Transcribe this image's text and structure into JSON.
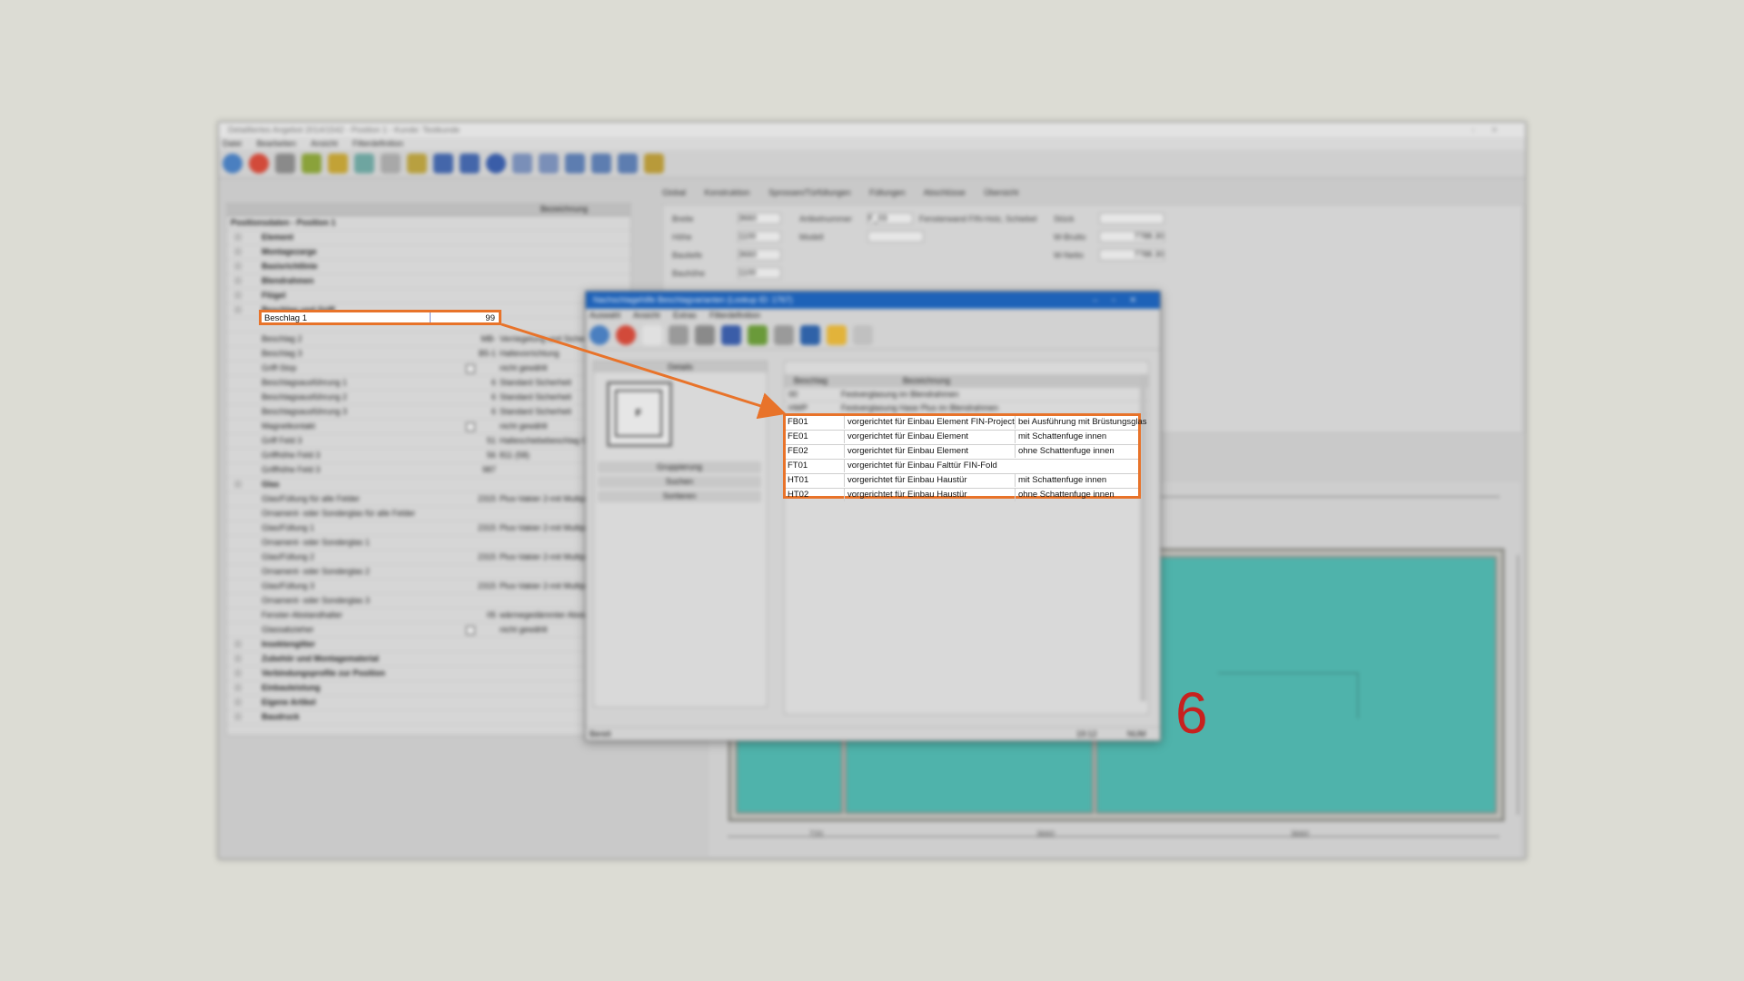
{
  "main_window": {
    "title": "Detailliertes Angebot 2014/1542 - Position 1 - Kunde: Testkunde",
    "menu": [
      "Datei",
      "Bearbeiten",
      "Ansicht",
      "Filterdefinition"
    ]
  },
  "tree": {
    "header_col": "Bezeichnung",
    "section_label": "Positionsdaten - Position 1",
    "rows": [
      {
        "label": "Element",
        "bold": true
      },
      {
        "label": "Montagezarge",
        "bold": true
      },
      {
        "label": "Basisrichtlinie",
        "bold": true
      },
      {
        "label": "Blendrahmen",
        "bold": true
      },
      {
        "label": "Flügel",
        "bold": true
      },
      {
        "label": "Beschlag und Griff",
        "bold": true
      },
      {
        "label": "",
        "bold": false,
        "highlight": true
      },
      {
        "label": "Beschlag 2",
        "num": "MB-",
        "desc": "Verriegelung und Sicherheit"
      },
      {
        "label": "Beschlag 3",
        "num": "B5-1",
        "desc": "Haltevorrichtung"
      },
      {
        "label": "Griff-Stop",
        "checkbox": true,
        "desc": "nicht gewählt"
      },
      {
        "label": "Beschlagsausführung 1",
        "num": "6",
        "desc": "Standard Sicherheit"
      },
      {
        "label": "Beschlagsausführung 2",
        "num": "6",
        "desc": "Standard Sicherheit"
      },
      {
        "label": "Beschlagsausführung 3",
        "num": "6",
        "desc": "Standard Sicherheit"
      },
      {
        "label": "Magnetkontakt",
        "checkbox": true,
        "desc": "nicht gewählt"
      },
      {
        "label": "Griff Feld 3",
        "num": "51",
        "desc": "Halteschiebebeschlag Griff"
      },
      {
        "label": "Griffhöhe Feld 3",
        "num": "56",
        "desc": "811 (58)"
      },
      {
        "label": "Griffhöhe Feld 3",
        "num": "987",
        "desc": ""
      },
      {
        "label": "Glas",
        "bold": true
      },
      {
        "label": "Glas/Füllung für alle Felder",
        "num": "2315",
        "desc": "Plus-Vakier 2-mit Multiprotect"
      },
      {
        "label": "Ornament- oder Sonderglas für alle Felder",
        "num": "",
        "desc": ""
      },
      {
        "label": "Glas/Füllung 1",
        "num": "2315",
        "desc": "Plus-Vakier 2-mit Multiprotect"
      },
      {
        "label": "Ornament- oder Sonderglas 1",
        "num": "",
        "desc": ""
      },
      {
        "label": "Glas/Füllung 2",
        "num": "2315",
        "desc": "Plus-Vakier 2-mit Multiprotect"
      },
      {
        "label": "Ornament- oder Sonderglas 2",
        "num": "",
        "desc": ""
      },
      {
        "label": "Glas/Füllung 3",
        "num": "2315",
        "desc": "Plus-Vakier 2-mit Multiprotect"
      },
      {
        "label": "Ornament- oder Sonderglas 3",
        "num": "",
        "desc": ""
      },
      {
        "label": "Fenster-Abstandhalter",
        "num": "05",
        "desc": "wärmegedämmter Abstandhalter"
      },
      {
        "label": "Glassabzieher",
        "checkbox": true,
        "desc": "nicht gewählt"
      },
      {
        "label": "Insektengitter",
        "bold": true
      },
      {
        "label": "Zubehör und Montagematerial",
        "bold": true
      },
      {
        "label": "Verbindungsprofile zur Position",
        "bold": true
      },
      {
        "label": "Einbauleistung",
        "bold": true
      },
      {
        "label": "Eigene Artikel",
        "bold": true
      },
      {
        "label": "Baudruck",
        "bold": true
      }
    ]
  },
  "highlight_row": {
    "label": "Beschlag 1",
    "value": "99"
  },
  "tabs": [
    "Global",
    "Konstruktion",
    "Sprossen/Türfüllungen",
    "Füllungen",
    "Abschlüsse",
    "Übersicht"
  ],
  "props": {
    "labels": [
      "Breite",
      "Höhe",
      "Bautiefe",
      "Bauhöhe",
      "Artikelnummer",
      "Modell",
      "Stück",
      "W-Brutto",
      "W-Netto"
    ],
    "values": [
      "3660",
      "1100",
      "3660",
      "1100",
      "F_03",
      "Fensterwand FIN-Holz, Schiebel",
      "7788.30",
      "7788.30"
    ]
  },
  "popup": {
    "title": "Nachschlagehilfe Beschlagvarianten (Lookup ID: 1767)",
    "menu": [
      "Auswahl",
      "Ansicht",
      "Extras",
      "Filterdefinition"
    ],
    "left_header": "Details",
    "preview_letter": "F",
    "left_buttons": [
      "Gruppierung",
      "Suchen",
      "Sortieren"
    ],
    "grid_headers": [
      "Beschlag",
      "Bezeichnung",
      ""
    ],
    "grid_top_rows": [
      {
        "code": "00",
        "desc": "Festverglasung im Blendrahmen",
        "note": ""
      },
      {
        "code": "HWP",
        "desc": "Festverglasung Hase Plus im Blendrahmen",
        "note": ""
      }
    ],
    "grid_highlight_rows": [
      {
        "code": "FB01",
        "desc": "vorgerichtet für Einbau Element FIN-Project",
        "note": "bei Ausführung mit Brüstungsglas"
      },
      {
        "code": "FE01",
        "desc": "vorgerichtet für Einbau Element",
        "note": "mit Schattenfuge innen"
      },
      {
        "code": "FE02",
        "desc": "vorgerichtet für Einbau Element",
        "note": "ohne Schattenfuge innen"
      },
      {
        "code": "FT01",
        "desc": "vorgerichtet für Einbau Falttür FIN-Fold",
        "note": ""
      },
      {
        "code": "HT01",
        "desc": "vorgerichtet für Einbau Haustür",
        "note": "mit Schattenfuge innen"
      },
      {
        "code": "HT02",
        "desc": "vorgerichtet für Einbau Haustür",
        "note": "ohne Schattenfuge innen"
      }
    ],
    "status_left": "Bereit",
    "status_mid": "19:12",
    "status_right": "NUM"
  },
  "drawing": {
    "dimension_labels": [
      "720",
      "3660",
      "3660"
    ],
    "field_number": "6"
  },
  "colors": {
    "accent_orange": "#e8732a",
    "dialog_title_blue": "#1e62b8",
    "glass_teal": "#4fb3ab",
    "number_red": "#c7211e"
  }
}
